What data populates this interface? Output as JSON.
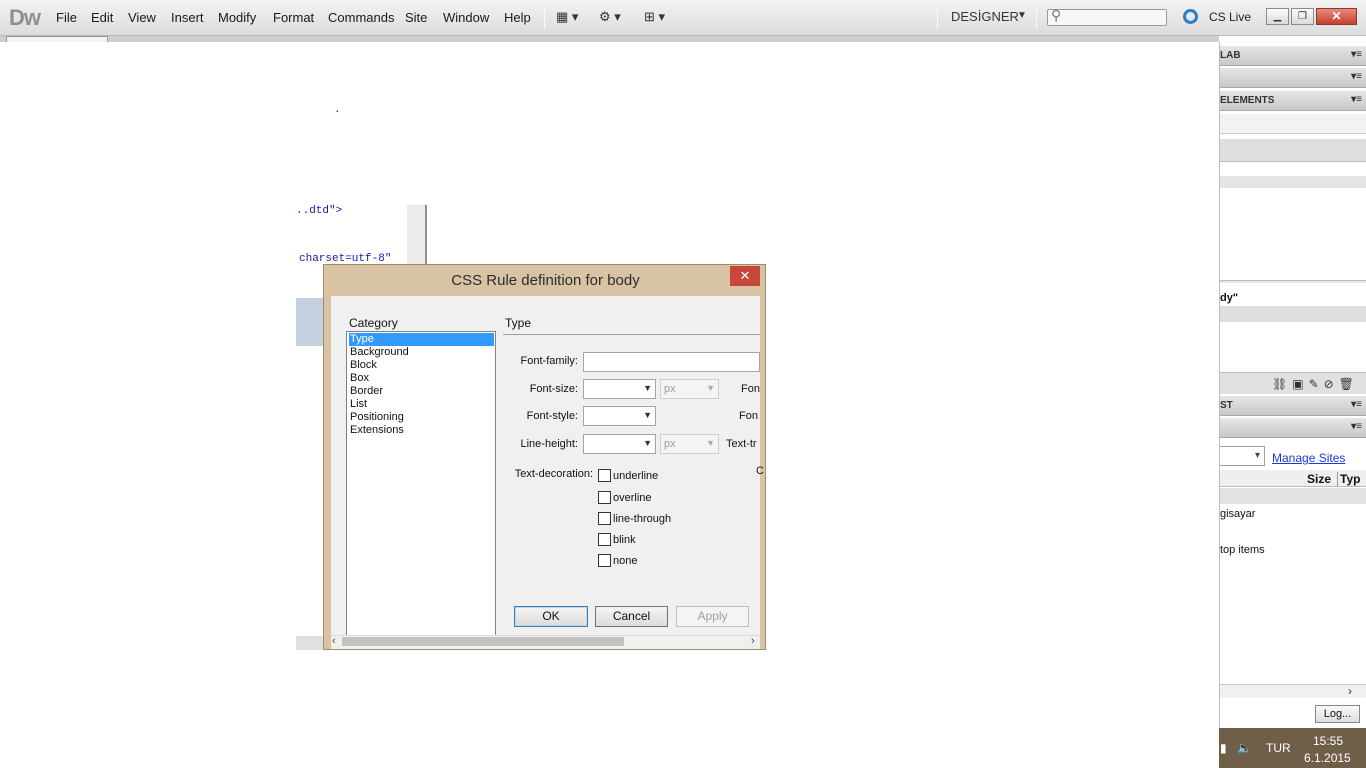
{
  "app": {
    "logo": "Dw",
    "menu": [
      "File",
      "Edit",
      "View",
      "Insert",
      "Modify",
      "Format",
      "Commands",
      "Site",
      "Window",
      "Help"
    ],
    "workspace": "DESİGNER",
    "cs_live": "CS Live",
    "toolbar_icons": [
      "layout-icon",
      "gear-icon",
      "site-icon"
    ]
  },
  "code": {
    "dot": ".",
    "dtd": "..dtd\">",
    "charset": " charset=utf-8\""
  },
  "panels": {
    "headers": [
      "LAB",
      "",
      "ELEMENTS",
      "ST"
    ],
    "css_fragment": "dy\"",
    "manage_sites": "Manage Sites",
    "columns": {
      "size": "Size",
      "type": "Typ"
    },
    "files": [
      "gisayar",
      "top items"
    ],
    "log_button": "Log..."
  },
  "taskbar": {
    "lang": "TUR",
    "time": "15:55",
    "date": "6.1.2015"
  },
  "dialog": {
    "title": "CSS Rule definition for body",
    "category_label": "Category",
    "categories": [
      "Type",
      "Background",
      "Block",
      "Box",
      "Border",
      "List",
      "Positioning",
      "Extensions"
    ],
    "selected_category": "Type",
    "section_title": "Type",
    "fields": {
      "font_family": {
        "label": "Font-family:",
        "value": ""
      },
      "font_size": {
        "label": "Font-size:",
        "value": "",
        "unit": "px"
      },
      "font_style": {
        "label": "Font-style:",
        "value": ""
      },
      "line_height": {
        "label": "Line-height:",
        "value": "",
        "unit": "px"
      },
      "text_decoration": {
        "label": "Text-decoration:"
      }
    },
    "cut_labels": {
      "r1": "Fon",
      "r2": "Fon",
      "r3": "Text-tr",
      "r4": "C"
    },
    "decorations": [
      {
        "label": "underline",
        "checked": false
      },
      {
        "label": "overline",
        "checked": false
      },
      {
        "label": "line-through",
        "checked": false
      },
      {
        "label": "blink",
        "checked": false
      },
      {
        "label": "none",
        "checked": false
      }
    ],
    "buttons": {
      "ok": "OK",
      "cancel": "Cancel",
      "apply": "Apply"
    }
  },
  "colors": {
    "selection": "#3399ff",
    "dialog_frame": "#d9c3a5",
    "close_red": "#c7473a",
    "link": "#1c39d6"
  }
}
